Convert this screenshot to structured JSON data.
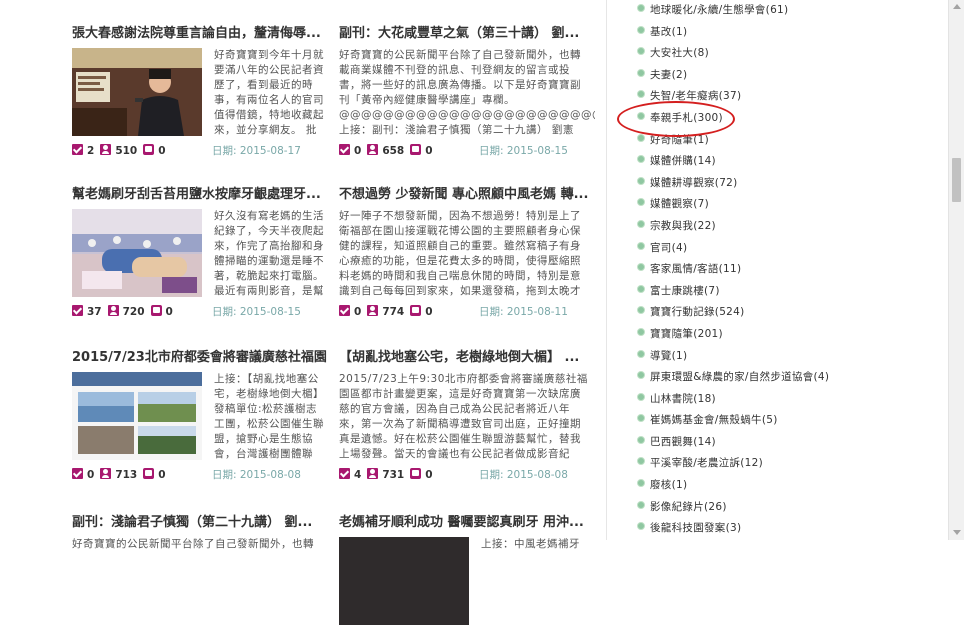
{
  "cards": [
    {
      "title": "張大春感謝法院尊重言論自由，釐清侮辱...",
      "text": "好奇寶寶到今年十月就要滿八年的公民記者資歷了，看到最近的時事，有兩位名人的官司值得借鏡，特地收藏起來，並分享網友。 批",
      "likes": "2",
      "views": "510",
      "comments": "0",
      "date": "日期: 2015-08-17",
      "has_image": true,
      "image": "speaker"
    },
    {
      "title": "副刊：大花咸豐草之氣（第三十講） 劉...",
      "text": "好奇寶寶的公民新聞平台除了自己發新聞外，也轉載商業媒體不刊登的訊息、刊登網友的留言或投書，將一些好的訊息廣為傳播。以下是好奇寶寶副刊「黃帝內經健康醫學講座」專欄。@@@@@@@@@@@@@@@@@@@@@@@@@@@@@@@上接：副刊：淺論君子慎獨（第二十九講） 劉憲",
      "likes": "0",
      "views": "658",
      "comments": "0",
      "date": "日期: 2015-08-15",
      "has_image": false
    },
    {
      "title": "幫老媽刷牙刮舌苔用鹽水按摩牙齦處理牙...",
      "text": "好久沒有寫老媽的生活紀錄了，今天半夜爬起來，作完了高抬腳和身體掃瞄的運動還是睡不著，乾脆起來打電腦。最近有兩則影音，是幫",
      "likes": "37",
      "views": "720",
      "comments": "0",
      "date": "日期: 2015-08-15",
      "has_image": true,
      "image": "bed"
    },
    {
      "title": "不想過勞 少發新聞 專心照顧中風老媽 轉...",
      "text": "好一陣子不想發新聞，因為不想過勞！特別是上了衛福部在園山接運戰花博公園的主要照顧者身心保健的課程，知道照顧自己的重要。雖然寫稿子有身心療癒的功能，但是花費太多的時間，使得壓縮照料老媽的時間和我自己喘息休閒的時間，特別是意識到自己每每回到家來，如果還發稿，拖到太晚才",
      "likes": "0",
      "views": "774",
      "comments": "0",
      "date": "日期: 2015-08-11",
      "has_image": false
    },
    {
      "title": "2015/7/23北市府都委會將審議廣慈社福園...",
      "text": "上接：【胡亂找地塞公宅，老樹綠地倒大楣】發稿單位:松菸護樹志工團，松菸公園催生聯盟，搶野心是生態協會，台灣護樹團體聯",
      "likes": "0",
      "views": "713",
      "comments": "0",
      "date": "日期: 2015-08-08",
      "has_image": true,
      "image": "screenshot"
    },
    {
      "title": "【胡亂找地塞公宅，老樹綠地倒大楣】 ...",
      "text": "2015/7/23上午9:30北市府都委會將審議廣慈社福園區都市計畫變更案，這是好奇寶寶第一次缺席廣慈的官方會議，因為自己成為公民記者將近八年來，第一次為了新聞稿導遭致官司出庭，正好撞期真是遺憾。好在松菸公園催生聯盟游藝幫忙，替我上場發聲。當天的會議也有公民記者做成影音紀錄，非",
      "likes": "4",
      "views": "731",
      "comments": "0",
      "date": "日期: 2015-08-08",
      "has_image": false
    },
    {
      "title": "副刊：淺論君子慎獨（第二十九講） 劉...",
      "text": "好奇寶寶的公民新聞平台除了自己發新聞外，也轉",
      "likes": "",
      "views": "",
      "comments": "",
      "date": "",
      "has_image": false
    },
    {
      "title": "老媽補牙順利成功 醫囑要認真刷牙 用沖...",
      "text": "上接：中風老媽補牙",
      "likes": "",
      "views": "",
      "comments": "",
      "date": "",
      "has_image": true,
      "image": "dark"
    }
  ],
  "sidebar": {
    "items": [
      "地球暖化/永續/生態學會(61)",
      "基改(1)",
      "大安社大(8)",
      "夫妻(2)",
      "失智/老年癡病(37)",
      "奉親手札(300)",
      "好奇隨筆(1)",
      "媒體併購(14)",
      "媒體耕導觀察(72)",
      "媒體觀察(7)",
      "宗教與我(22)",
      "官司(4)",
      "客家風情/客語(11)",
      "富士康跳樓(7)",
      "寶寶行動記錄(524)",
      "寶寶隨筆(201)",
      "導覽(1)",
      "屏東環盟&綠農的家/自然步道協會(4)",
      "山林書院(18)",
      "崔媽媽基金會/無殼蝸牛(5)",
      "巴西觀舞(14)",
      "平溪宰酸/老農泣訴(12)",
      "廢核(1)",
      "影像紀錄片(26)",
      "後龍科技園發案(3)"
    ]
  },
  "colors": {
    "accent": "#a8186f",
    "date": "#7aa8a8",
    "bullet": "#8fc7a1",
    "annotation": "#d41f1f"
  },
  "icons": {
    "likes": "check-icon",
    "views": "person-icon",
    "comments": "comment-icon"
  }
}
